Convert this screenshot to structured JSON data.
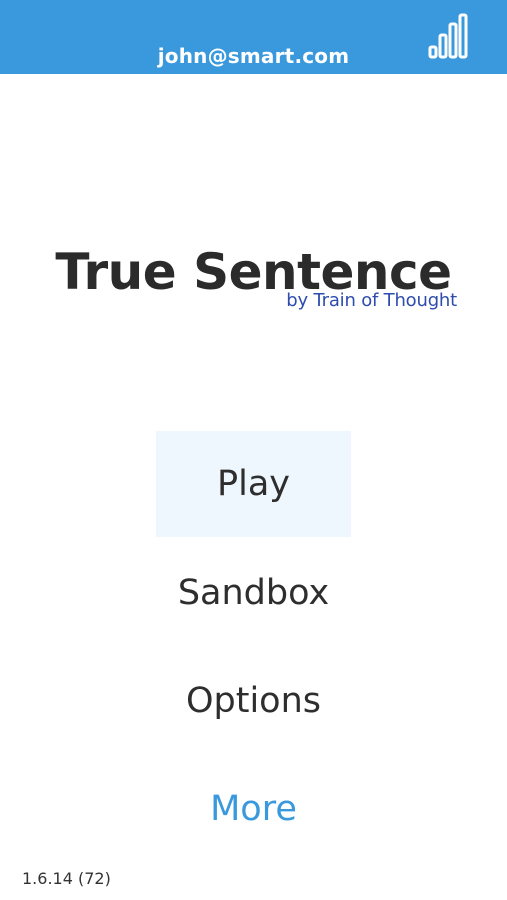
{
  "header": {
    "account_email": "john@smart.com",
    "stats_icon": "bar-chart-icon",
    "background_color": "#3a99dc"
  },
  "title": {
    "app_name": "True Sentence",
    "byline": "by Train of Thought"
  },
  "menu": {
    "items": [
      {
        "label": "Play",
        "selected": true
      },
      {
        "label": "Sandbox",
        "selected": false
      },
      {
        "label": "Options",
        "selected": false
      },
      {
        "label": "More",
        "selected": false,
        "accent": true
      }
    ],
    "selected_background": "#eef7fd",
    "accent_color": "#3a99dc"
  },
  "footer": {
    "version": "1.6.14 (72)"
  }
}
